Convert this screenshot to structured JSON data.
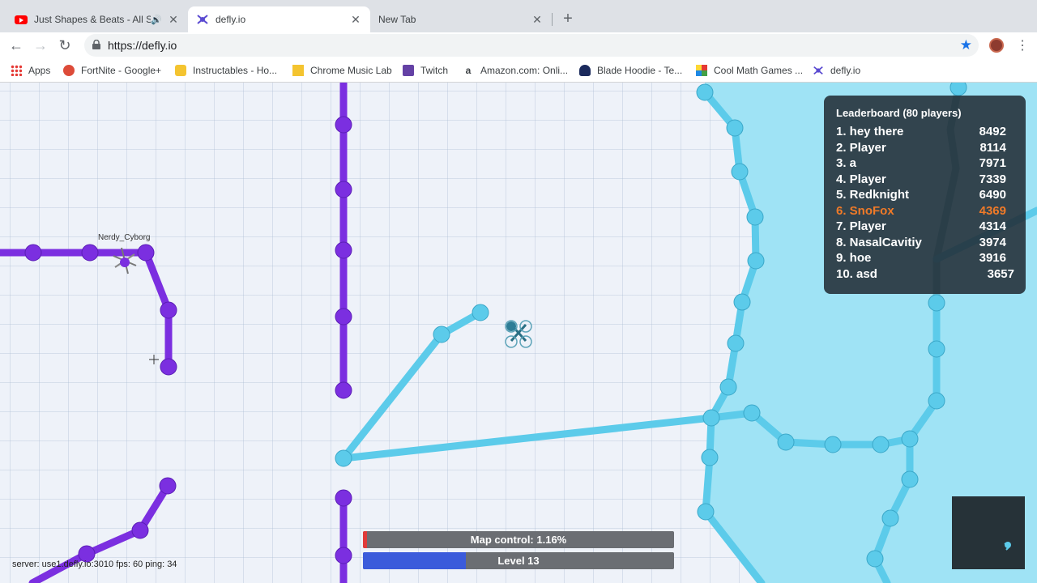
{
  "browser": {
    "tabs": [
      {
        "title": "Just Shapes & Beats - All S",
        "icon": "youtube-icon",
        "active": false,
        "audio": true
      },
      {
        "title": "defly.io",
        "icon": "defly-icon",
        "active": true
      },
      {
        "title": "New Tab",
        "icon": "",
        "active": false
      }
    ],
    "url": "https://defly.io",
    "bookmarks": [
      {
        "label": "Apps",
        "icon": "apps-grid-icon"
      },
      {
        "label": "FortNite - Google+",
        "icon": "google-plus-icon"
      },
      {
        "label": "Instructables - Ho...",
        "icon": "instructables-icon"
      },
      {
        "label": "Chrome Music Lab",
        "icon": "music-lab-icon"
      },
      {
        "label": "Twitch",
        "icon": "twitch-icon"
      },
      {
        "label": "Amazon.com: Onli...",
        "icon": "amazon-icon"
      },
      {
        "label": "Blade Hoodie - Te...",
        "icon": "hoodie-icon"
      },
      {
        "label": "Cool Math Games ...",
        "icon": "coolmath-icon"
      },
      {
        "label": "defly.io",
        "icon": "defly-icon"
      }
    ]
  },
  "game": {
    "leaderboard": {
      "title": "Leaderboard (80 players)",
      "rows": [
        {
          "name": "1. hey there",
          "score": "8492"
        },
        {
          "name": "2. Player",
          "score": "8114"
        },
        {
          "name": "3. a",
          "score": "7971"
        },
        {
          "name": "4. Player",
          "score": "7339"
        },
        {
          "name": "5. Redknight",
          "score": "6490"
        },
        {
          "name": "6. SnoFox",
          "score": "4369",
          "highlight": true
        },
        {
          "name": "7. Player",
          "score": "4314"
        },
        {
          "name": "8. NasalCavitiy",
          "score": "3974"
        },
        {
          "name": "9. hoe",
          "score": "3916"
        },
        {
          "name": "10. asd",
          "score": "3657"
        }
      ]
    },
    "player_name_label": "Nerdy_Cyborg",
    "map_control": {
      "label": "Map control: 1.16%",
      "percent": 1.16
    },
    "level": {
      "label": "Level 13",
      "progress": 0.33
    },
    "server_info": "server: use1.defly.io:3010 fps: 60 ping: 34",
    "colors": {
      "purple": "#7b2fe0",
      "cyan": "#5ccbea",
      "territory": "#9fe3f5",
      "highlight": "#f07a28",
      "map_control_fill": "#e03a3a",
      "level_fill": "#3b5bdb"
    }
  }
}
